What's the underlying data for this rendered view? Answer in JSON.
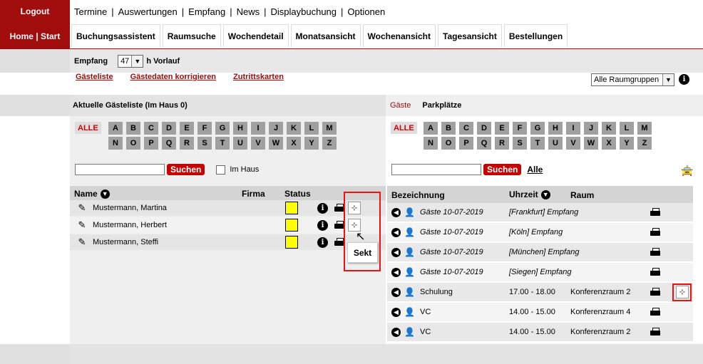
{
  "sidebar": {
    "logout": "Logout",
    "home": "Home | Start"
  },
  "topnav": [
    "Termine",
    "Auswertungen",
    "Empfang",
    "News",
    "Displaybuchung",
    "Optionen"
  ],
  "tabs": [
    "Buchungsassistent",
    "Raumsuche",
    "Wochendetail",
    "Monatsansicht",
    "Wochenansicht",
    "Tagesansicht",
    "Bestellungen"
  ],
  "subbar": {
    "label": "Empfang",
    "vorlauf_value": "47",
    "vorlauf_label": "h Vorlauf"
  },
  "links": [
    "Gästeliste",
    "Gästedaten korrigieren",
    "Zutrittskarten"
  ],
  "raumgruppe": "Alle Raumgruppen",
  "left": {
    "header": "Aktuelle Gästeliste (Im Haus 0)",
    "alle": "ALLE",
    "letters": [
      "A",
      "B",
      "C",
      "D",
      "E",
      "F",
      "G",
      "H",
      "I",
      "J",
      "K",
      "L",
      "M",
      "N",
      "O",
      "P",
      "Q",
      "R",
      "S",
      "T",
      "U",
      "V",
      "W",
      "X",
      "Y",
      "Z"
    ],
    "search_button": "Suchen",
    "imhaus_label": "Im Haus",
    "columns": {
      "name": "Name",
      "firma": "Firma",
      "status": "Status"
    },
    "guests": [
      {
        "name": "Mustermann, Martina"
      },
      {
        "name": "Mustermann, Herbert"
      },
      {
        "name": "Mustermann, Steffi"
      }
    ],
    "tooltip": "Sekt"
  },
  "right": {
    "tab_gaeste": "Gäste",
    "tab_parkplaetze": "Parkplätze",
    "alle": "ALLE",
    "letters": [
      "A",
      "B",
      "C",
      "D",
      "E",
      "F",
      "G",
      "H",
      "I",
      "J",
      "K",
      "L",
      "M",
      "N",
      "O",
      "P",
      "Q",
      "R",
      "S",
      "T",
      "U",
      "V",
      "W",
      "X",
      "Y",
      "Z"
    ],
    "search_button": "Suchen",
    "alle_link": "Alle",
    "columns": {
      "bezeichnung": "Bezeichnung",
      "uhrzeit": "Uhrzeit",
      "raum": "Raum"
    },
    "rows": [
      {
        "bez": "Gäste 10-07-2019",
        "uhrzeit": "[Frankfurt] Empfang",
        "raum": "",
        "italic": true
      },
      {
        "bez": "Gäste 10-07-2019",
        "uhrzeit": "[Köln] Empfang",
        "raum": "",
        "italic": true
      },
      {
        "bez": "Gäste 10-07-2019",
        "uhrzeit": "[München] Empfang",
        "raum": "",
        "italic": true
      },
      {
        "bez": "Gäste 10-07-2019",
        "uhrzeit": "[Siegen] Empfang",
        "raum": "",
        "italic": true
      },
      {
        "bez": "Schulung",
        "uhrzeit": "17.00 - 18.00",
        "raum": "Konferenzraum 2",
        "italic": false
      },
      {
        "bez": "VC",
        "uhrzeit": "14.00 - 15.00",
        "raum": "Konferenzraum 4",
        "italic": false
      },
      {
        "bez": "VC",
        "uhrzeit": "14.00 - 15.00",
        "raum": "Konferenzraum 2",
        "italic": false
      }
    ]
  },
  "colors": {
    "brand": "#a10d0d",
    "button": "#c40000",
    "status_yellow": "#ffff00",
    "highlight_box": "#e11111"
  }
}
